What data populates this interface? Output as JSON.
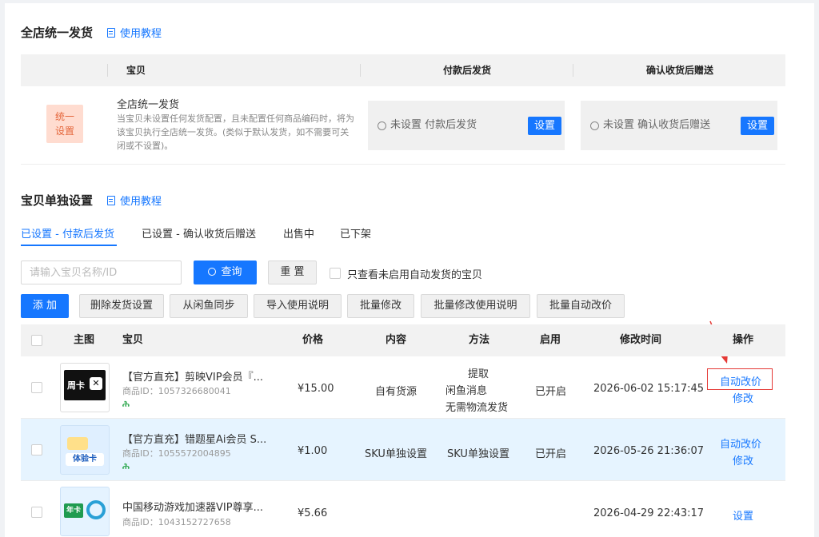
{
  "global_section": {
    "title": "全店统一发货",
    "tutorial": "使用教程",
    "headers": {
      "item": "宝贝",
      "after_payment": "付款后发货",
      "after_receipt": "确认收货后赠送"
    },
    "badge_line1": "统一",
    "badge_line2": "设置",
    "name": "全店统一发货",
    "description": "当宝贝未设置任何发货配置，且未配置任何商品编码时，将为该宝贝执行全店统一发货。(类似于默认发货，如不需要可关闭或不设置)。",
    "after_payment_status": "未设置 付款后发货",
    "after_receipt_status": "未设置 确认收货后赠送",
    "set_button": "设置"
  },
  "item_section": {
    "title": "宝贝单独设置",
    "tutorial": "使用教程"
  },
  "tabs": [
    {
      "label": "已设置 - 付款后发货",
      "active": true
    },
    {
      "label": "已设置 - 确认收货后赠送",
      "active": false
    },
    {
      "label": "出售中",
      "active": false
    },
    {
      "label": "已下架",
      "active": false
    }
  ],
  "search": {
    "placeholder": "请输入宝贝名称/ID",
    "query_button": "查询",
    "reset_button": "重 置",
    "only_unenabled_label": "只查看未启用自动发货的宝贝"
  },
  "toolbar": {
    "add": "添 加",
    "delete": "删除发货设置",
    "sync": "从闲鱼同步",
    "import_guide": "导入使用说明",
    "batch_edit": "批量修改",
    "batch_edit_guide": "批量修改使用说明",
    "batch_auto_price": "批量自动改价"
  },
  "table": {
    "headers": {
      "image": "主图",
      "item": "宝贝",
      "price": "价格",
      "content": "内容",
      "method": "方法",
      "enabled": "启用",
      "modified": "修改时间",
      "actions": "操作"
    },
    "rows": [
      {
        "thumb_text": "周卡",
        "title": "【官方直充】剪映VIP会员『...",
        "id_label": "商品ID：1057326680041",
        "price": "¥15.00",
        "content": "自有货源",
        "method_1": "提取",
        "method_2": "闲鱼消息",
        "method_3": "无需物流发货",
        "enabled": "已开启",
        "modified": "2026-06-02 15:17:45",
        "action_1": "自动改价",
        "action_2": "修改"
      },
      {
        "thumb_text": "体验卡",
        "title": "【官方直充】错题星Ai会员 S...",
        "id_label": "商品ID：1055572004895",
        "price": "¥1.00",
        "content": "SKU单独设置",
        "method": "SKU单独设置",
        "enabled": "已开启",
        "modified": "2026-05-26 21:36:07",
        "action_1": "自动改价",
        "action_2": "修改"
      },
      {
        "thumb_text": "年卡",
        "title": "中国移动游戏加速器VIP尊享...",
        "id_label": "商品ID：1043152727658",
        "price": "¥5.66",
        "modified": "2026-04-29 22:43:17",
        "action_1": "设置"
      }
    ]
  },
  "colors": {
    "accent": "#1677ff",
    "badge_bg": "#ffdcd0",
    "badge_text": "#e5673c",
    "highlight_row": "#e6f4ff",
    "annotation_red": "#e53935"
  }
}
